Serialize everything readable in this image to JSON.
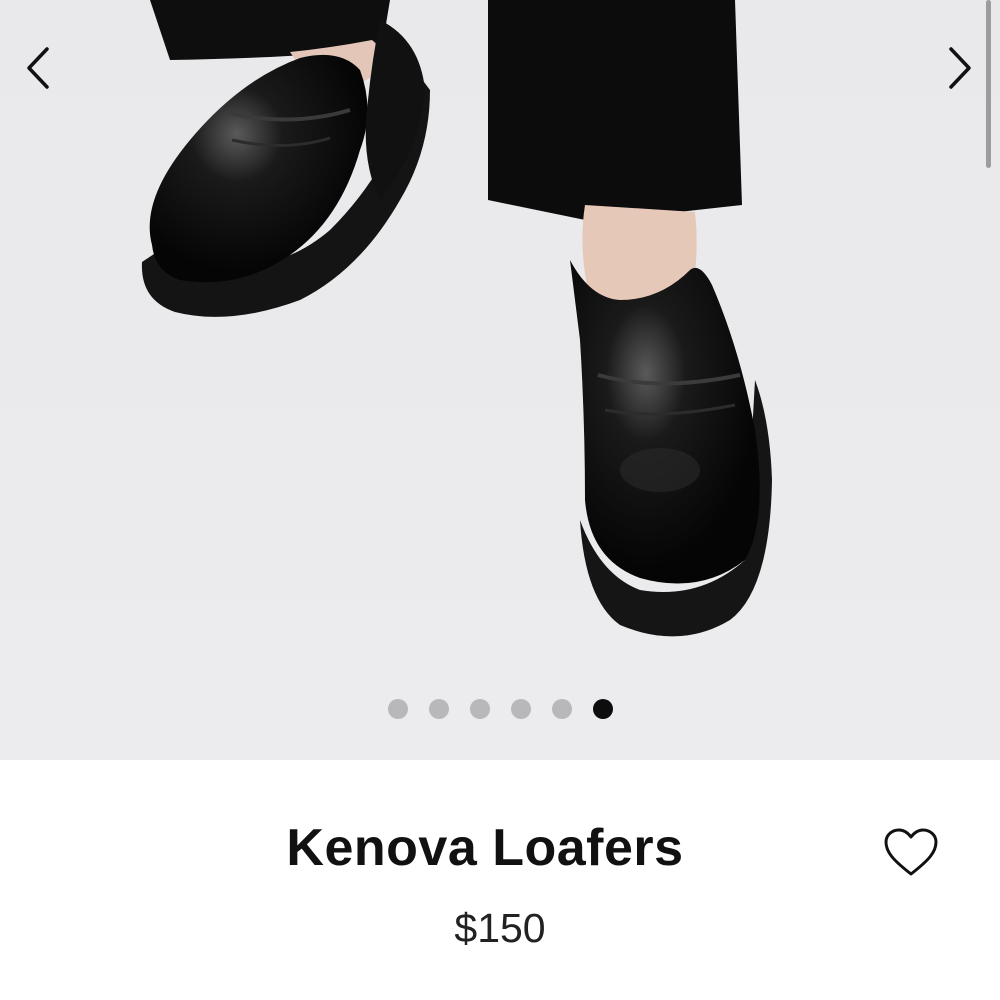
{
  "gallery": {
    "image_count": 6,
    "active_index": 5,
    "prev_icon": "chevron-left-icon",
    "next_icon": "chevron-right-icon"
  },
  "product": {
    "title": "Kenova Loafers",
    "price": "$150",
    "wishlist_icon": "heart-outline-icon"
  },
  "colors": {
    "gallery_bg": "#ebebed",
    "dot_inactive": "#b8b8bb",
    "dot_active": "#0d0d0d",
    "text": "#111111"
  }
}
